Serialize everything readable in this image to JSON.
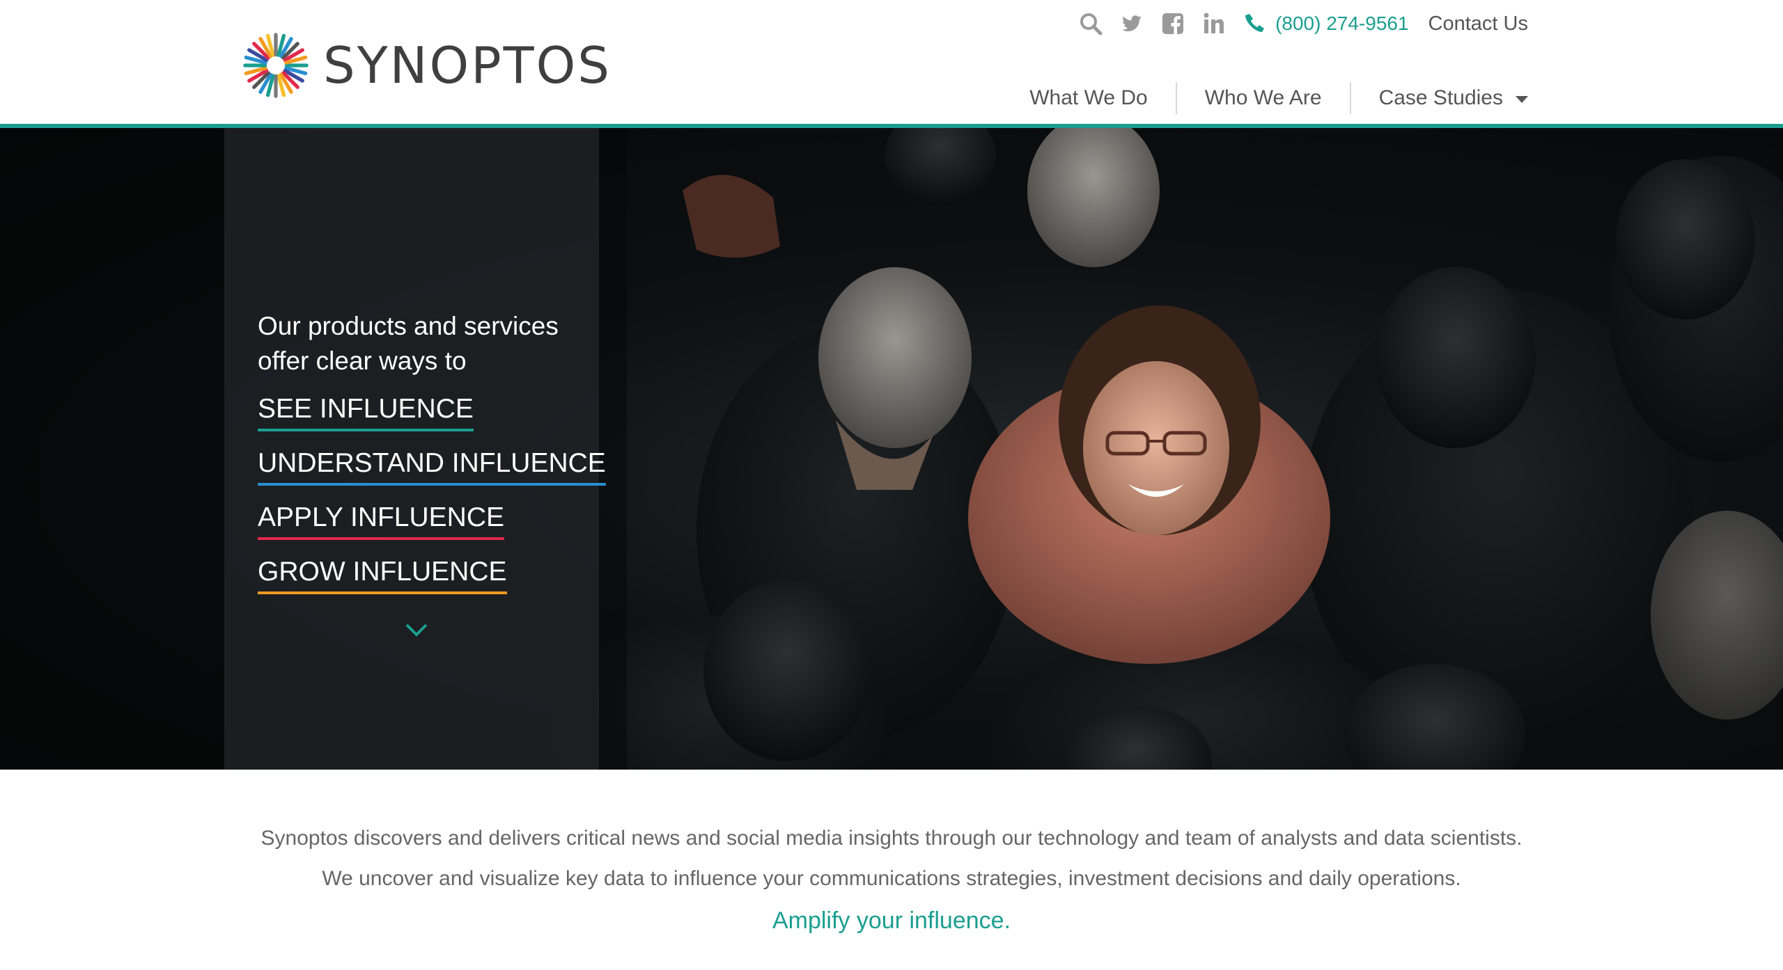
{
  "brand": {
    "name": "SYNOPTOS",
    "accent": "#1a9e8f"
  },
  "utility": {
    "icons": [
      "search-icon",
      "twitter-icon",
      "facebook-icon",
      "linkedin-icon",
      "phone-icon"
    ],
    "phone": "(800) 274-9561",
    "contact": "Contact Us"
  },
  "nav": {
    "items": [
      {
        "label": "What We Do"
      },
      {
        "label": "Who We Are"
      },
      {
        "label": "Case Studies",
        "dropdown": true
      }
    ]
  },
  "hero": {
    "intro": "Our products and services offer clear ways to",
    "links": [
      {
        "label": "SEE INFLUENCE",
        "color": "#1a9e8f"
      },
      {
        "label": "UNDERSTAND INFLUENCE",
        "color": "#2a8fd0"
      },
      {
        "label": "APPLY INFLUENCE",
        "color": "#e2294b"
      },
      {
        "label": "GROW INFLUENCE",
        "color": "#f39b20"
      }
    ],
    "scroll_icon": "chevron-down-icon"
  },
  "about": {
    "line1": "Synoptos discovers and delivers critical news and social media insights through our technology and team of analysts and data scientists.",
    "line2": "We uncover and visualize key data to influence your communications strategies, investment decisions and daily operations.",
    "tagline": "Amplify your influence."
  }
}
